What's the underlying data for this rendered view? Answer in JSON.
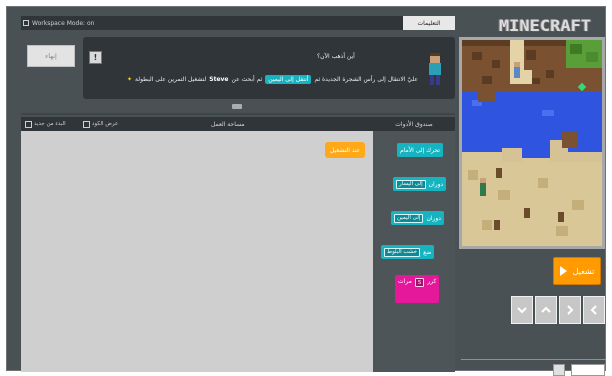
{
  "logo": {
    "text": "MINECRAFT"
  },
  "controls": {
    "run_label": "تشغيل",
    "arrows": [
      "left-arrow",
      "right-arrow",
      "up-arrow",
      "down-arrow"
    ]
  },
  "header": {
    "tab_label": "التعليمات",
    "workspace_link": "Workspace Mode: on"
  },
  "instructions": {
    "title": "أين أذهب الآن؟",
    "text_before": "عليّ الانتقال إلى رأس الشجرة الجديدة ثم",
    "highlight": "أنتقل إلى اليمين",
    "text_middle": "ثم أبحث عن",
    "bold": "Steve",
    "text_after": "لتشغيل التمرين على البطولة"
  },
  "finish_label": "إنهاء",
  "toolbox": {
    "title": "صندوق الأدوات",
    "blocks": [
      {
        "label": "تحرك إلى الأمام",
        "color": "cyan"
      },
      {
        "label": "دوران",
        "field": "إلى اليسار",
        "color": "cyan"
      },
      {
        "label": "دوران",
        "field": "إلى اليمين",
        "color": "cyan"
      },
      {
        "label": "ضع",
        "field": "خشب البلوط",
        "color": "cyan"
      },
      {
        "label": "كرر",
        "field": "5",
        "suffix": "مرات",
        "color": "pink"
      }
    ]
  },
  "workspace": {
    "title": "مساحة العمل",
    "tool1": "البدء من جديد",
    "tool2": "عرض الكود",
    "when_run": "عند التشغيل"
  },
  "colors": {
    "accent_orange": "#ff9a00",
    "block_cyan": "#16b3c0",
    "block_pink": "#e5179a",
    "panel_dark": "#2f3538"
  }
}
